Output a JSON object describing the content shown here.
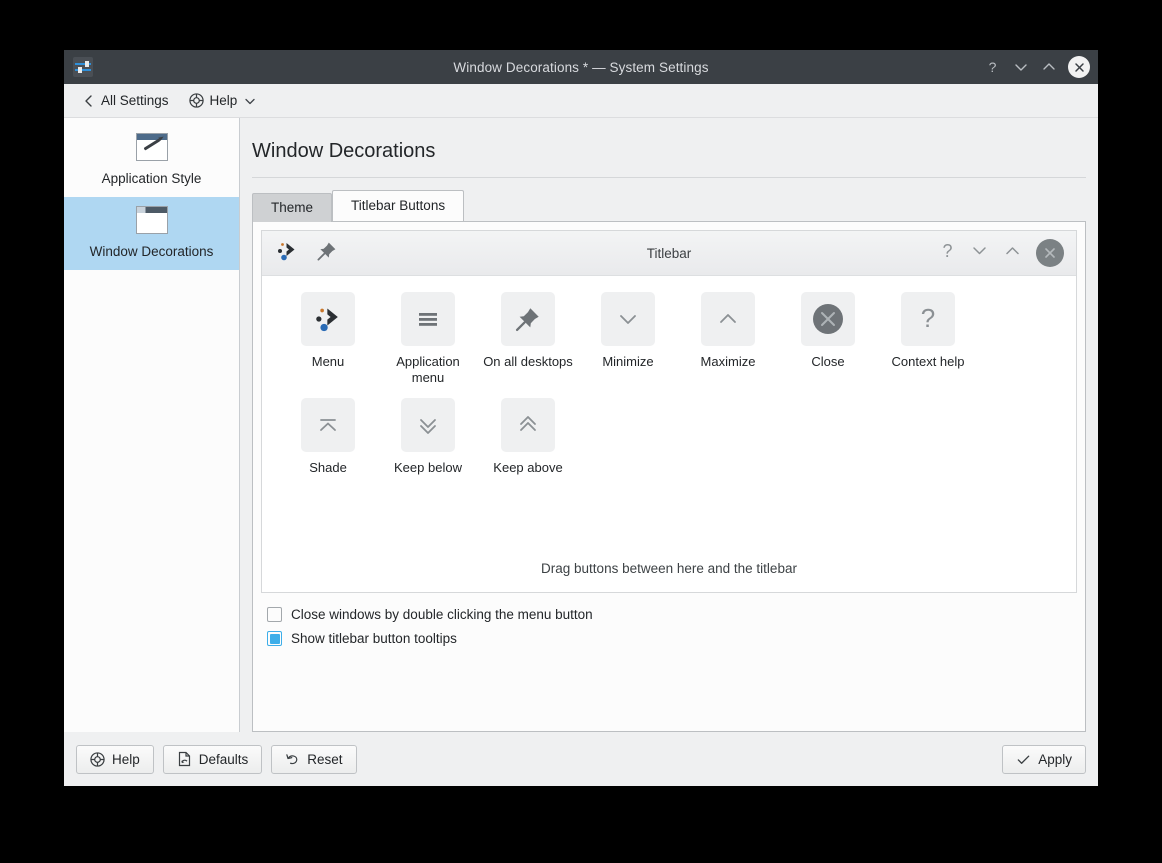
{
  "window": {
    "title": "Window Decorations * — System Settings",
    "app_icon": "settings-sliders-icon",
    "controls": {
      "help": "?",
      "minimize": "chevron-down-icon",
      "maximize": "chevron-up-icon",
      "close": "close-icon"
    }
  },
  "toolbar": {
    "back_label": "All Settings",
    "back_icon": "chevron-left-icon",
    "help_label": "Help",
    "help_icon": "lifebuoy-icon",
    "help_chevron": "chevron-down-icon"
  },
  "sidebar": {
    "items": [
      {
        "label": "Application Style",
        "icon": "window-pencil-icon",
        "selected": false
      },
      {
        "label": "Window Decorations",
        "icon": "window-titlebar-icon",
        "selected": true
      }
    ]
  },
  "main": {
    "page_title": "Window Decorations",
    "tabs": [
      {
        "label": "Theme",
        "active": false
      },
      {
        "label": "Titlebar Buttons",
        "active": true
      }
    ],
    "preview": {
      "title": "Titlebar",
      "left_buttons": [
        {
          "name": "menu",
          "icon": "kde-menu-icon"
        },
        {
          "name": "on-all-desktops",
          "icon": "pin-icon"
        }
      ],
      "right_buttons": [
        {
          "name": "context-help",
          "icon": "question-mark-icon"
        },
        {
          "name": "minimize",
          "icon": "chevron-down-icon"
        },
        {
          "name": "maximize",
          "icon": "chevron-up-icon"
        },
        {
          "name": "close",
          "icon": "circle-close-icon"
        }
      ]
    },
    "available_buttons": [
      {
        "label": "Menu",
        "icon": "kde-menu-icon"
      },
      {
        "label": "Application menu",
        "icon": "hamburger-icon"
      },
      {
        "label": "On all desktops",
        "icon": "pin-icon"
      },
      {
        "label": "Minimize",
        "icon": "chevron-down-icon"
      },
      {
        "label": "Maximize",
        "icon": "chevron-up-icon"
      },
      {
        "label": "Close",
        "icon": "circle-close-icon"
      },
      {
        "label": "Context help",
        "icon": "question-mark-icon"
      },
      {
        "label": "Shade",
        "icon": "shade-icon"
      },
      {
        "label": "Keep below",
        "icon": "double-chevron-down-icon"
      },
      {
        "label": "Keep above",
        "icon": "double-chevron-up-icon"
      }
    ],
    "drag_hint": "Drag buttons between here and the titlebar",
    "options": [
      {
        "label": "Close windows by double clicking the menu button",
        "checked": false
      },
      {
        "label": "Show titlebar button tooltips",
        "checked": true
      }
    ]
  },
  "footer": {
    "help_label": "Help",
    "help_icon": "lifebuoy-icon",
    "defaults_label": "Defaults",
    "defaults_icon": "document-revert-icon",
    "reset_label": "Reset",
    "reset_icon": "undo-arrow-icon",
    "apply_label": "Apply",
    "apply_icon": "checkmark-icon"
  },
  "colors": {
    "titlebar_bg": "#3b4045",
    "window_bg": "#eff0f1",
    "selection": "#afd7f2",
    "accent": "#3daee9",
    "panel_bg": "#fcfcfc"
  }
}
